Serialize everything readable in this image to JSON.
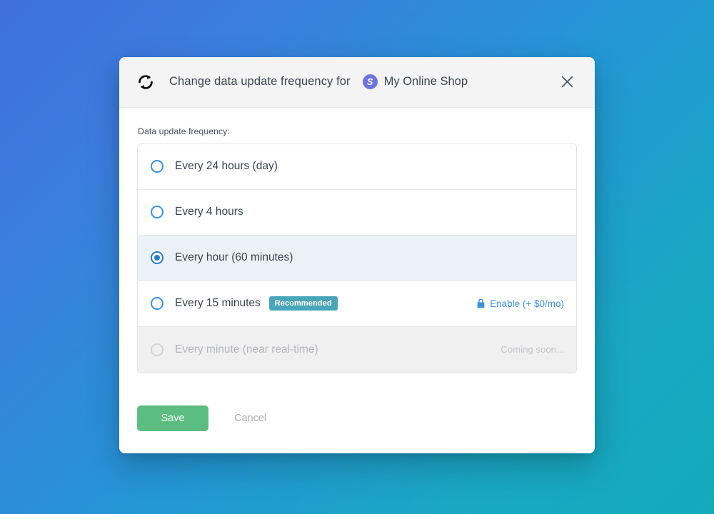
{
  "dialog": {
    "sync_icon": "sync-refresh-icon",
    "title": "Change data update frequency for",
    "shop": {
      "avatar_letter": "S",
      "avatar_color": "#6d74e0",
      "name": "My Online Shop"
    },
    "close_icon": "close-icon",
    "field_label": "Data update frequency:",
    "options": [
      {
        "label": "Every 24 hours (day)",
        "selected": false,
        "disabled": false,
        "badge": null,
        "action": null,
        "status": null
      },
      {
        "label": "Every 4 hours",
        "selected": false,
        "disabled": false,
        "badge": null,
        "action": null,
        "status": null
      },
      {
        "label": "Every hour (60 minutes)",
        "selected": true,
        "disabled": false,
        "badge": null,
        "action": null,
        "status": null
      },
      {
        "label": "Every 15 minutes",
        "selected": false,
        "disabled": false,
        "badge": "Recommended",
        "action": "Enable (+ $0/mo)",
        "action_icon": "lock-icon",
        "status": null
      },
      {
        "label": "Every minute (near real-time)",
        "selected": false,
        "disabled": true,
        "badge": null,
        "action": null,
        "status": "Coming soon..."
      }
    ],
    "footer": {
      "save_label": "Save",
      "cancel_label": "Cancel"
    }
  },
  "colors": {
    "accent_blue": "#3d92d9",
    "selected_row_bg": "#eaf1f8",
    "badge_teal": "#49a6b8",
    "save_green": "#5bbd7f",
    "avatar_purple": "#6d74e0",
    "background_gradient_from": "#3f6fdb",
    "background_gradient_to": "#13abbc"
  }
}
